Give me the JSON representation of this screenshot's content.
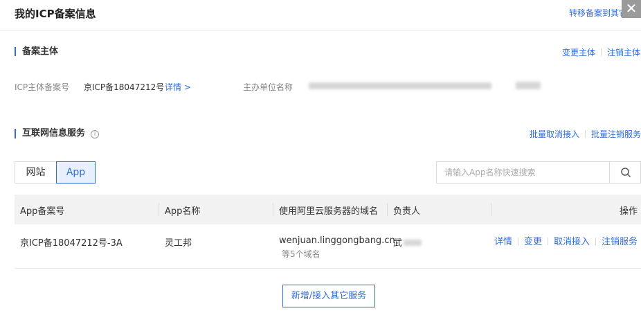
{
  "header": {
    "title": "我的ICP备案信息",
    "transfer_link": "转移备案到其它账号",
    "close_symbol": "✕"
  },
  "subject": {
    "section_title": "备案主体",
    "change_link": "变更主体",
    "cancel_link": "注销主体",
    "icp_label": "ICP主体备案号",
    "icp_value": "京ICP备18047212号",
    "detail_link": "详情 >",
    "org_label": "主办单位名称"
  },
  "services": {
    "section_title": "互联网信息服务",
    "info_icon": "i",
    "batch_unlink": "批量取消接入",
    "batch_cancel": "批量注销服务",
    "tabs": [
      {
        "label": "网站",
        "active": false
      },
      {
        "label": "App",
        "active": true
      }
    ],
    "search_placeholder": "请输入App名称快速搜索",
    "search_icon": "search-icon"
  },
  "table": {
    "columns": [
      "App备案号",
      "App名称",
      "使用阿里云服务器的域名",
      "负责人",
      "操作"
    ],
    "rows": [
      {
        "record_no": "京ICP备18047212号-3A",
        "app_name": "灵工邦",
        "domain": "wenjuan.linggongbang.cn",
        "domain_extra": "等5个域名",
        "owner": "武",
        "actions": [
          "详情",
          "变更",
          "取消接入",
          "注销服务"
        ]
      }
    ]
  },
  "footer": {
    "add_button": "新增/接入其它服务"
  },
  "colors": {
    "accent": "#2f6bd8",
    "header_bg": "#f2f2f2"
  }
}
